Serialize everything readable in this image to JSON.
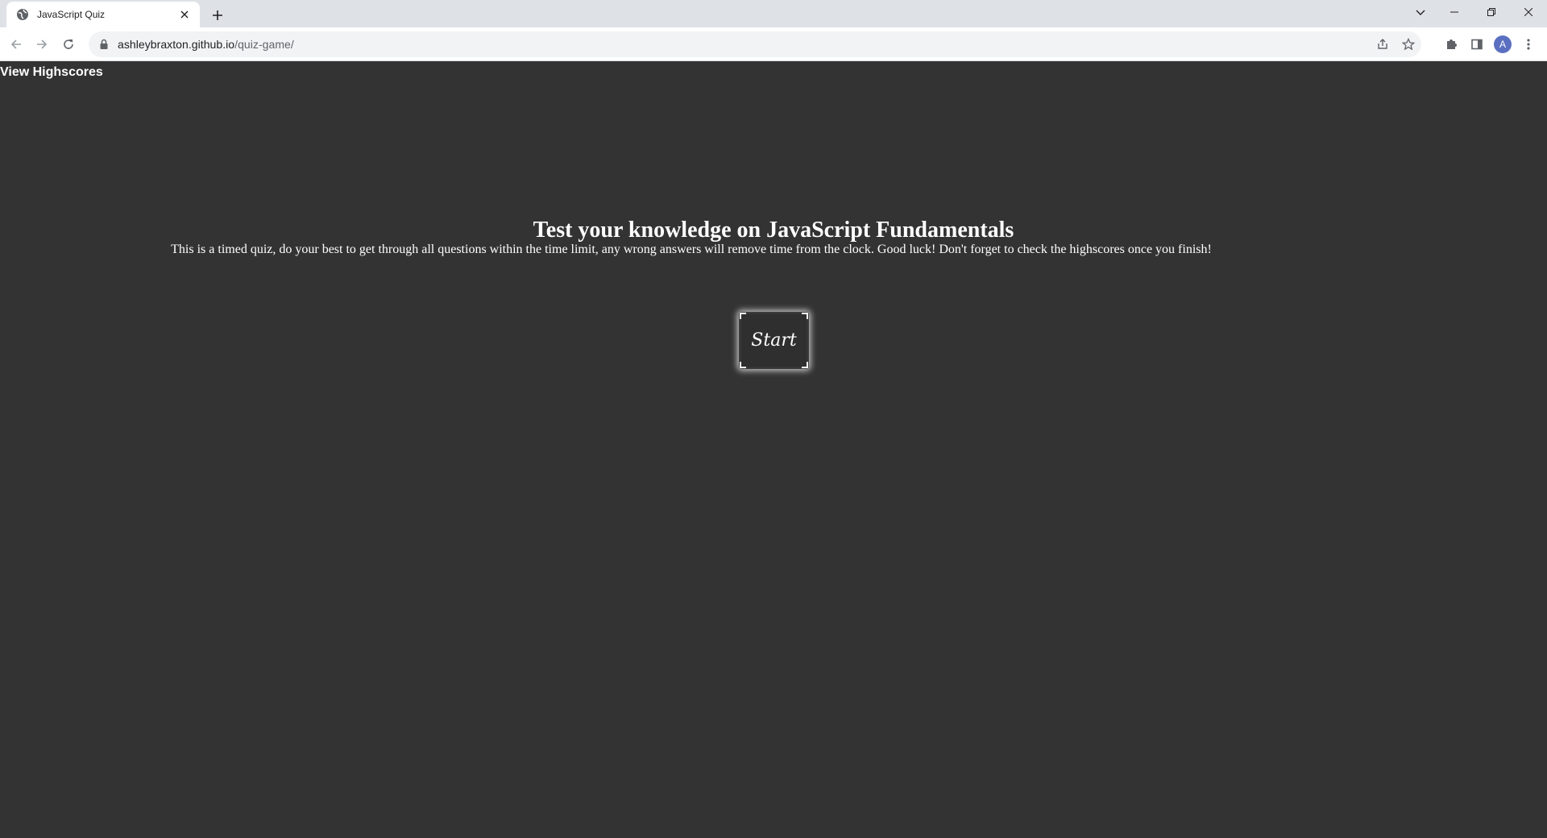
{
  "browser": {
    "tab": {
      "title": "JavaScript Quiz",
      "favicon": "globe-icon"
    },
    "url": {
      "host": "ashleybraxton.github.io",
      "path": "/quiz-game/"
    },
    "profile_initial": "A"
  },
  "page": {
    "highscores_link": "View Highscores",
    "title": "Test your knowledge on JavaScript Fundamentals",
    "description": "This is a timed quiz, do your best to get through all questions within the time limit, any wrong answers will remove time from the clock. Good luck! Don't forget to check the highscores once you finish!",
    "start_button": "Start"
  },
  "colors": {
    "page_background": "#333333",
    "text": "#ffffff",
    "avatar": "#5a6fc0"
  }
}
